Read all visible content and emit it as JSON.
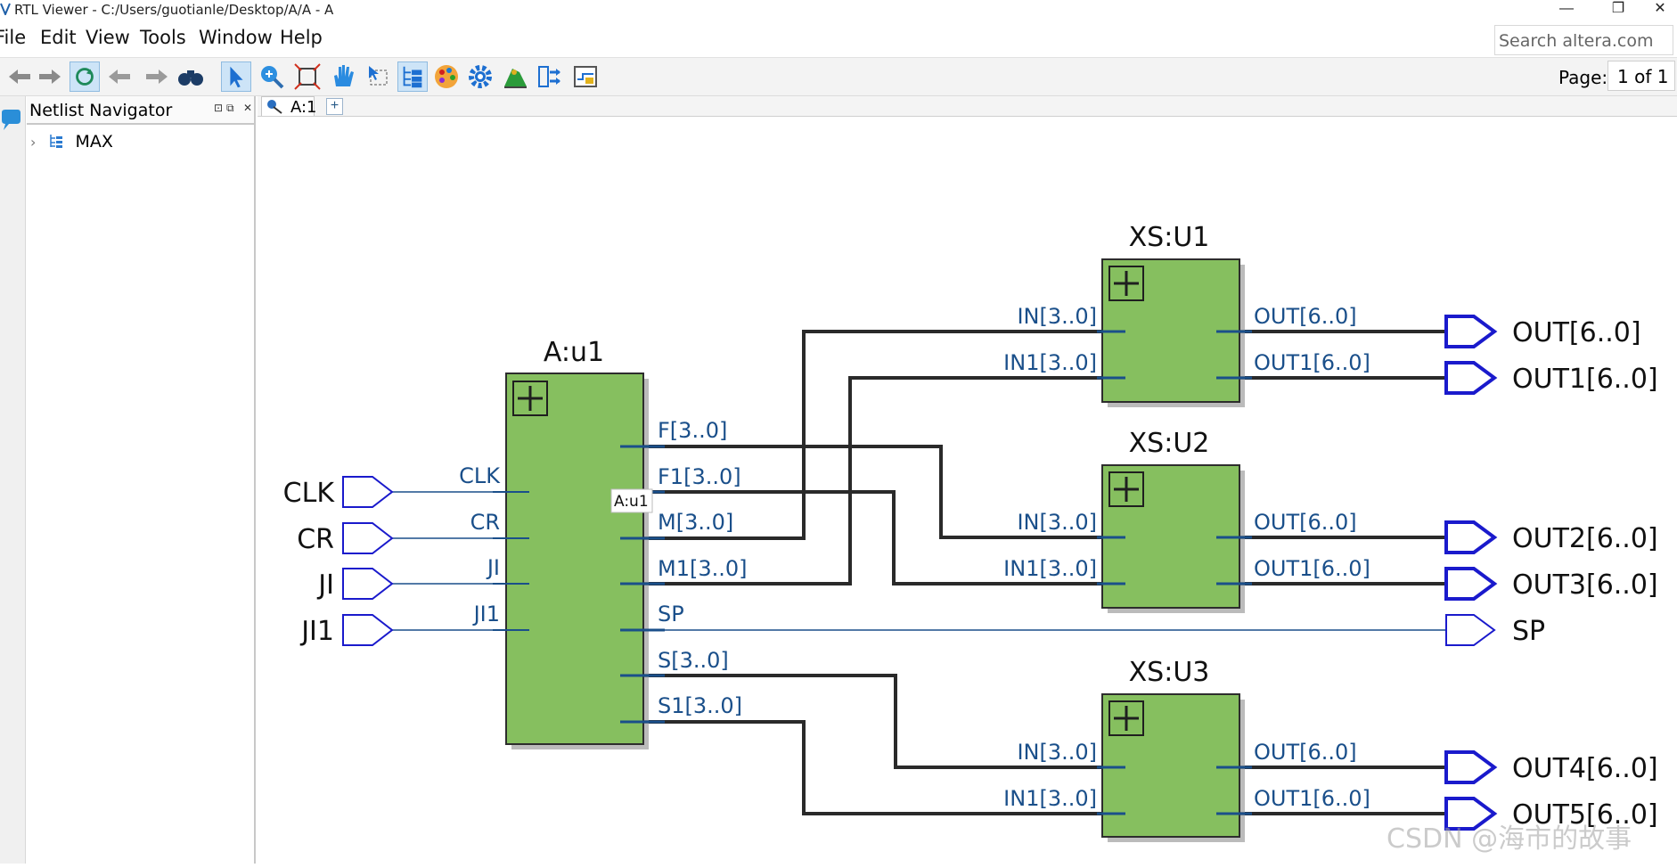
{
  "window": {
    "title": "RTL Viewer - C:/Users/guotianle/Desktop/A/A - A",
    "minimize": "—",
    "restore": "❐",
    "close": "✕"
  },
  "menu": [
    "File",
    "Edit",
    "View",
    "Tools",
    "Window",
    "Help"
  ],
  "search": {
    "placeholder": "Search altera.com"
  },
  "page": {
    "label": "Page:",
    "value": "1 of 1"
  },
  "navigator": {
    "title": "Netlist Navigator",
    "root": "MAX"
  },
  "tab": {
    "label": "A:1",
    "add": "+"
  },
  "schematic": {
    "inputs": [
      "CLK",
      "CR",
      "JI",
      "JI1"
    ],
    "main": {
      "name": "A:u1",
      "in_ports": [
        "CLK",
        "CR",
        "JI",
        "JI1"
      ],
      "out_ports": [
        "F[3..0]",
        "F1[3..0]",
        "M[3..0]",
        "M1[3..0]",
        "SP",
        "S[3..0]",
        "S1[3..0]"
      ],
      "tooltip": "A:u1"
    },
    "subs": [
      {
        "name": "XS:U1",
        "in0": "IN[3..0]",
        "in1": "IN1[3..0]",
        "out0": "OUT[6..0]",
        "out1": "OUT1[6..0]"
      },
      {
        "name": "XS:U2",
        "in0": "IN[3..0]",
        "in1": "IN1[3..0]",
        "out0": "OUT[6..0]",
        "out1": "OUT1[6..0]"
      },
      {
        "name": "XS:U3",
        "in0": "IN[3..0]",
        "in1": "IN1[3..0]",
        "out0": "OUT[6..0]",
        "out1": "OUT1[6..0]"
      }
    ],
    "outputs": [
      "OUT[6..0]",
      "OUT1[6..0]",
      "OUT2[6..0]",
      "OUT3[6..0]",
      "SP",
      "OUT4[6..0]",
      "OUT5[6..0]"
    ]
  },
  "colors": {
    "block": "#86bf5f",
    "pin": "#1a1acc",
    "port_text": "#1a4f8a",
    "wire": "#2a2a2a"
  },
  "watermark": "CSDN @海市的故事"
}
